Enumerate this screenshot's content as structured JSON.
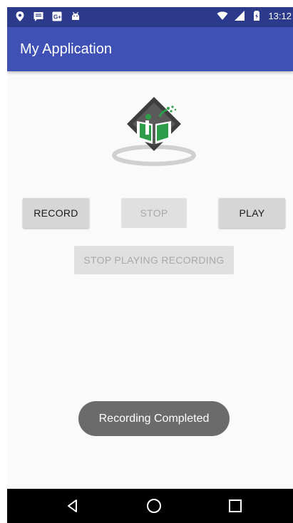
{
  "status_bar": {
    "time": "13:12",
    "left_icons": [
      "location-pin-icon",
      "message-icon",
      "google-plus-icon",
      "android-icon"
    ],
    "right_icons": [
      "wifi-icon",
      "cellular-signal-icon",
      "battery-icon"
    ]
  },
  "app_bar": {
    "title": "My Application",
    "color": "#3f51b5"
  },
  "logo": {
    "name": "logo-image"
  },
  "buttons": {
    "record": "RECORD",
    "stop": "STOP",
    "play": "PLAY",
    "stop_playing": "STOP PLAYING RECORDING"
  },
  "toast": {
    "message": "Recording Completed"
  },
  "nav_bar": {
    "icons": [
      "back-icon",
      "home-icon",
      "recents-icon"
    ]
  }
}
